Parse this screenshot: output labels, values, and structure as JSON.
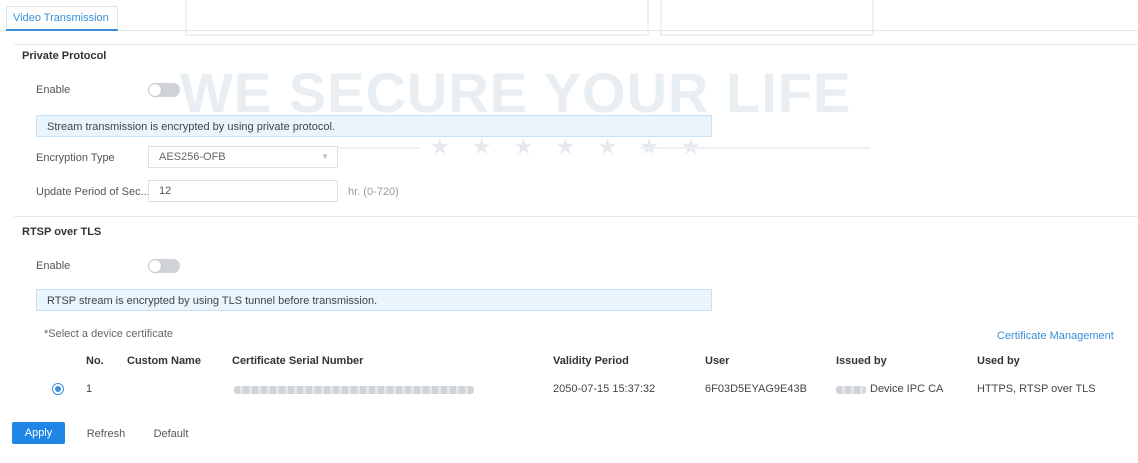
{
  "tabs": [
    {
      "label": "Video Transmission",
      "active": true
    }
  ],
  "watermark": {
    "slogan": "WE SECURE YOUR LIFE",
    "stars": "★ ★ ★ ★ ★ ★ ★"
  },
  "private_protocol": {
    "title": "Private Protocol",
    "enable_label": "Enable",
    "enable_state": "off",
    "info": "Stream transmission is encrypted by using private protocol.",
    "encryption_type_label": "Encryption Type",
    "encryption_type_value": "AES256-OFB",
    "update_period_label": "Update Period of Sec...",
    "update_period_value": "12",
    "update_period_unit": "hr. (0-720)"
  },
  "rtsp_tls": {
    "title": "RTSP over TLS",
    "enable_label": "Enable",
    "enable_state": "off",
    "info": "RTSP stream is encrypted by using TLS tunnel before transmission.",
    "select_cert_label": "*Select a device certificate",
    "cert_mgmt_link": "Certificate Management",
    "columns": [
      "No.",
      "Custom Name",
      "Certificate Serial Number",
      "Validity Period",
      "User",
      "Issued by",
      "Used by"
    ],
    "rows": [
      {
        "no": "1",
        "custom_name": "",
        "validity": "2050-07-15 15:37:32",
        "user": "6F03D5EYAG9E43B",
        "issued_by": "Device IPC CA",
        "used_by": "HTTPS, RTSP over TLS",
        "selected": true
      }
    ]
  },
  "buttons": {
    "apply": "Apply",
    "refresh": "Refresh",
    "default": "Default"
  },
  "colors": {
    "accent": "#1f86e6",
    "info_bg": "#eaf4fc",
    "toggle_off": "#cfd3d7"
  }
}
